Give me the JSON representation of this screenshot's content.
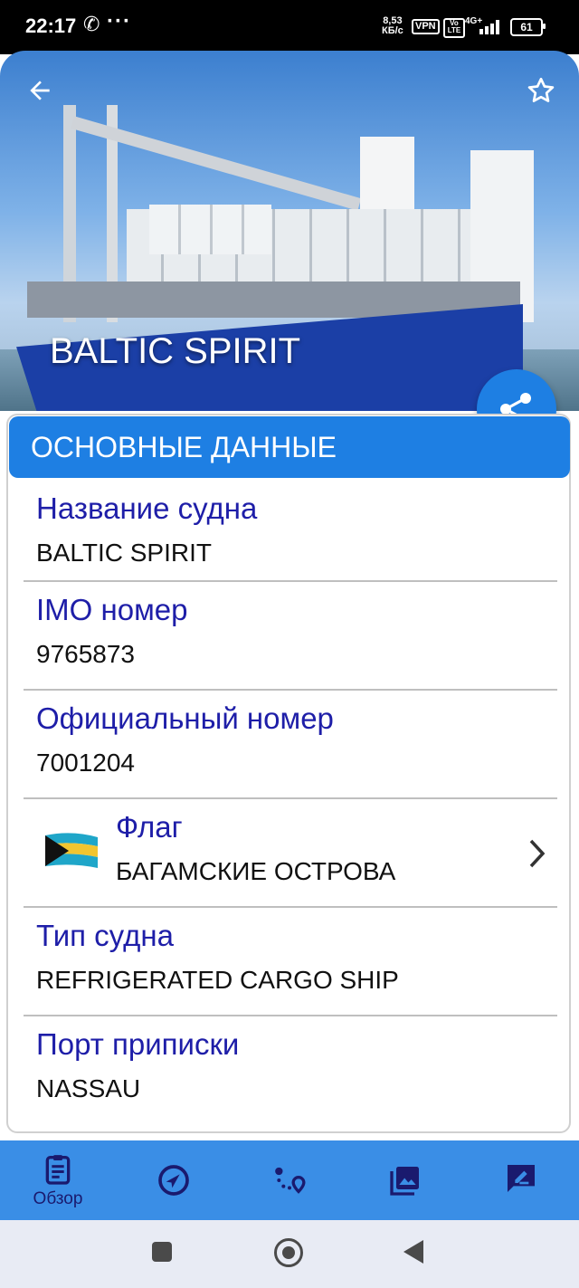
{
  "status_bar": {
    "time": "22:17",
    "speed_value": "8,53",
    "speed_unit": "КБ/с",
    "vpn": "VPN",
    "volte": "Vo LTE",
    "network": "4G+",
    "battery": "61"
  },
  "hero": {
    "ship_name": "BALTIC SPIRIT",
    "back_icon": "arrow-left-icon",
    "favorite_icon": "star-outline-icon",
    "share_icon": "share-icon"
  },
  "card": {
    "header": "ОСНОВНЫЕ ДАННЫЕ",
    "rows": [
      {
        "label": "Название судна",
        "value": "BALTIC SPIRIT"
      },
      {
        "label": "IMO номер",
        "value": "9765873"
      },
      {
        "label": "Официальный номер",
        "value": "7001204"
      },
      {
        "label": "Флаг",
        "value": "БАГАМСКИЕ ОСТРОВА"
      },
      {
        "label": "Тип судна",
        "value": "REFRIGERATED CARGO SHIP"
      },
      {
        "label": "Порт приписки",
        "value": "NASSAU"
      }
    ]
  },
  "bottom_nav": {
    "items": [
      {
        "label": "Обзор",
        "icon": "clipboard-icon",
        "active": true
      },
      {
        "label": "",
        "icon": "navigation-icon"
      },
      {
        "label": "",
        "icon": "route-icon"
      },
      {
        "label": "",
        "icon": "gallery-icon"
      },
      {
        "label": "",
        "icon": "feedback-icon"
      }
    ]
  },
  "colors": {
    "accent": "#1e7fe3",
    "label": "#1e1ea8",
    "nav_bg": "#3a8ee6"
  }
}
